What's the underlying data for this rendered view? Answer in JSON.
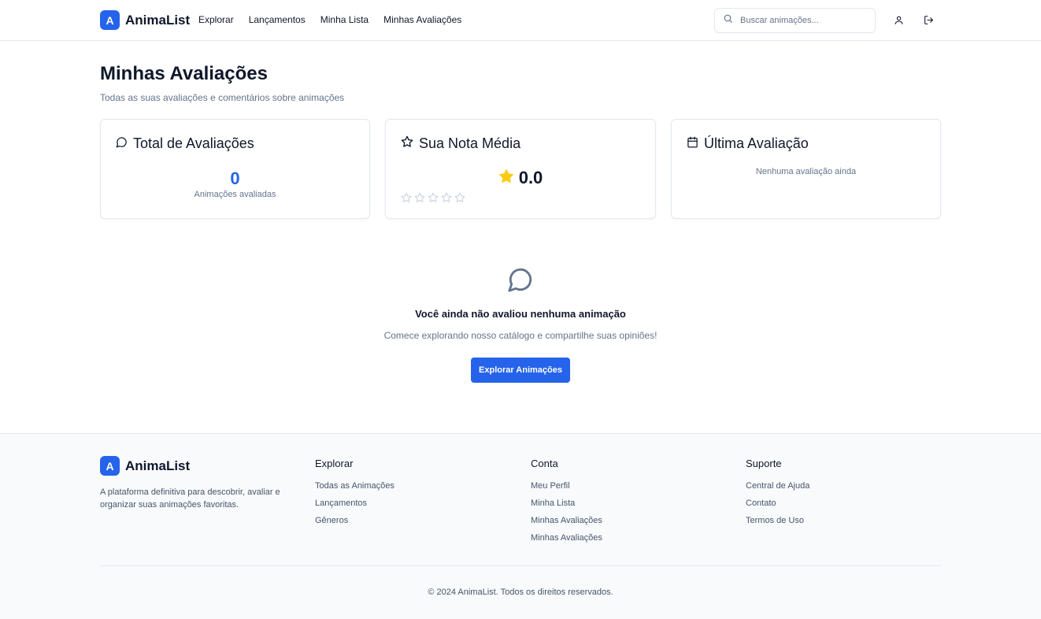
{
  "brand": {
    "letter": "A",
    "name": "AnimaList",
    "color": "#2563eb"
  },
  "nav": {
    "items": [
      "Explorar",
      "Lançamentos",
      "Minha Lista",
      "Minhas Avaliações"
    ]
  },
  "search": {
    "placeholder": "Buscar animações...",
    "icon": "search-icon"
  },
  "header_icons": {
    "profile": "user-icon",
    "logout": "logout-icon"
  },
  "page": {
    "title": "Minhas Avaliações",
    "subtitle": "Todas as suas avaliações e comentários sobre animações"
  },
  "cards": {
    "total": {
      "title": "Total de Avaliações",
      "value": "0",
      "caption": "Animações avaliadas",
      "icon": "message-circle-icon"
    },
    "average": {
      "title": "Sua Nota Média",
      "value": "0.0",
      "icon": "star-outline-icon",
      "star_count": 5,
      "filled_stars": 0
    },
    "last": {
      "title": "Última Avaliação",
      "text": "Nenhuma avaliação ainda",
      "icon": "calendar-icon"
    }
  },
  "empty_state": {
    "icon": "message-circle-icon",
    "title": "Você ainda não avaliou nenhuma animação",
    "subtitle": "Comece explorando nosso catálogo e compartilhe suas opiniões!",
    "button": "Explorar Animações"
  },
  "footer": {
    "description": "A plataforma definitiva para descobrir, avaliar e organizar suas animações favoritas.",
    "columns": [
      {
        "title": "Explorar",
        "links": [
          "Todas as Animações",
          "Lançamentos",
          "Gêneros"
        ]
      },
      {
        "title": "Conta",
        "links": [
          "Meu Perfil",
          "Minha Lista",
          "Minhas Avaliações",
          "Minhas Avaliações"
        ]
      },
      {
        "title": "Suporte",
        "links": [
          "Central de Ajuda",
          "Contato",
          "Termos de Uso"
        ]
      }
    ],
    "copyright": "© 2024 AnimaList. Todos os direitos reservados."
  },
  "colors": {
    "accent": "#2563eb",
    "star": "#facc15",
    "muted": "#64748b"
  }
}
